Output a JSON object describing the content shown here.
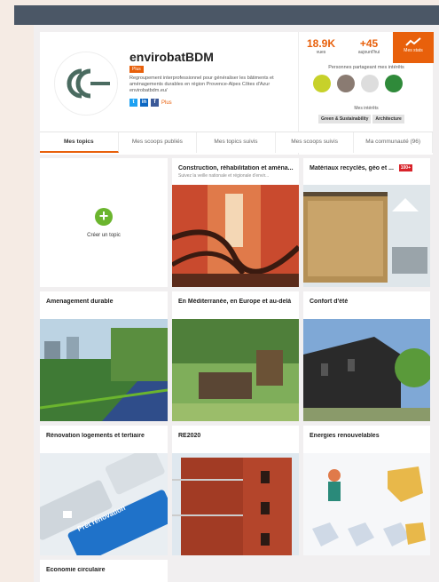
{
  "profile": {
    "name": "envirobatBDM",
    "plus_badge": "Plus",
    "description": "Regroupement interprofessionnel pour généraliser les bâtiments et aménagements durables en région Provence-Alpes Côtes d'Azur envirobatbdm.eu/",
    "socials_more": "Plus"
  },
  "stats": {
    "views_num": "18.9K",
    "views_label": "vues",
    "today_num": "+45",
    "today_label": "aujourd'hui",
    "mystats_label": "Mes stats",
    "share_title": "Personnes partageant mes intérêts",
    "interests_title": "Mes intérêts",
    "interests": [
      "Green & Sustainability",
      "Architecture"
    ]
  },
  "tabs": [
    "Mes topics",
    "Mes scoops publiés",
    "Mes topics suivis",
    "Mes scoops suivis",
    "Ma communauté (96)"
  ],
  "create_label": "Créer un topic",
  "topics": [
    {
      "title": "Construction, réhabilitation et aména...",
      "subtitle": "Suivez la veille nationale et régionale d'envir..."
    },
    {
      "title": "Matériaux recyclés, géo et ...",
      "subtitle": "",
      "badge": "100+"
    },
    {
      "title": "Amenagement durable"
    },
    {
      "title": "En Méditerranée, en Europe et au-delà"
    },
    {
      "title": "Confort d'été"
    },
    {
      "title": "Rénovation logements et tertiaire"
    },
    {
      "title": "RE2020"
    },
    {
      "title": "Energies renouvelables"
    },
    {
      "title": "Economie circulaire"
    }
  ],
  "images": {
    "keyboard_text": "Prêt rénovation"
  }
}
